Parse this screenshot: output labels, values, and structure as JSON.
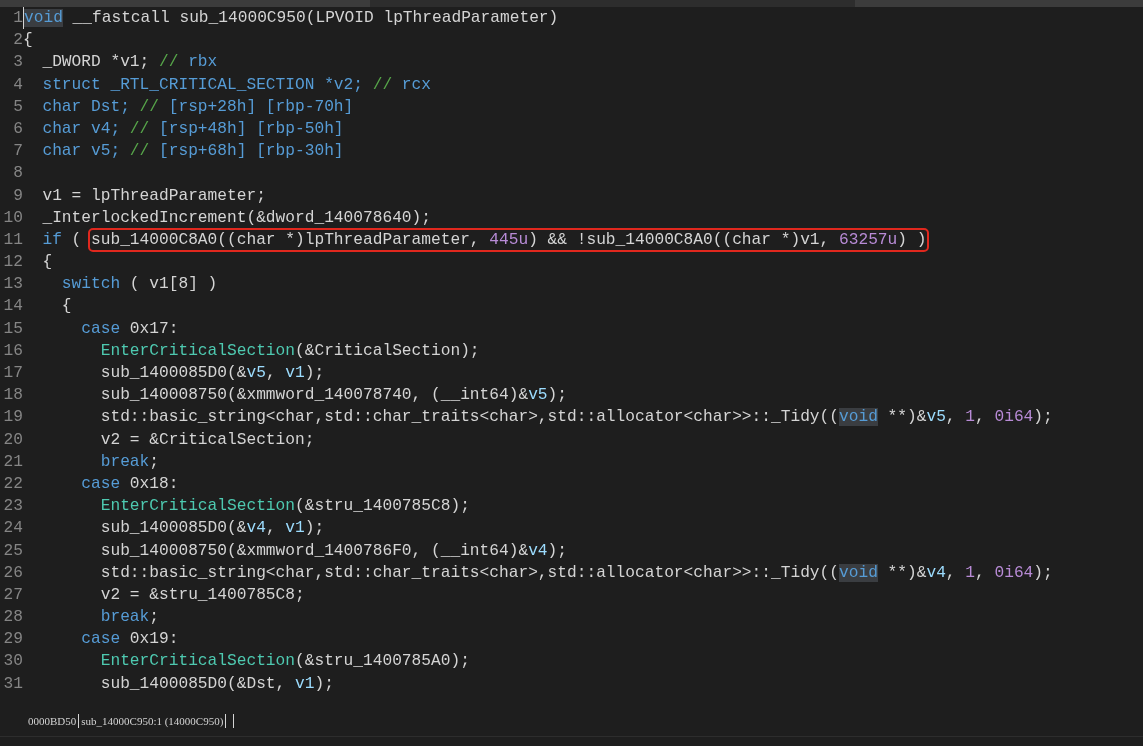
{
  "code_lines": [
    {
      "number": "1",
      "cursor": true,
      "tokens": [
        {
          "kind": "keyword",
          "text": "void",
          "hl": true
        },
        {
          "kind": "plain",
          "text": " __fastcall sub_14000C950(LPVOID lpThreadParameter)"
        }
      ]
    },
    {
      "number": "2",
      "cursor": false,
      "tokens": [
        {
          "kind": "plain",
          "text": "{"
        }
      ]
    },
    {
      "number": "3",
      "cursor": false,
      "tokens": [
        {
          "kind": "plain",
          "text": "  _DWORD *v1; "
        },
        {
          "kind": "comment",
          "text": "//"
        },
        {
          "kind": "register",
          "text": " rbx"
        }
      ]
    },
    {
      "number": "4",
      "cursor": false,
      "tokens": [
        {
          "kind": "keyword",
          "text": "  struct _RTL_CRITICAL_SECTION *v2; "
        },
        {
          "kind": "comment",
          "text": "//"
        },
        {
          "kind": "register",
          "text": " rcx"
        }
      ]
    },
    {
      "number": "5",
      "cursor": false,
      "tokens": [
        {
          "kind": "keyword",
          "text": "  char Dst; "
        },
        {
          "kind": "comment",
          "text": "//"
        },
        {
          "kind": "register",
          "text": " [rsp+28h] [rbp-70h]"
        }
      ]
    },
    {
      "number": "6",
      "cursor": false,
      "tokens": [
        {
          "kind": "keyword",
          "text": "  char v4; "
        },
        {
          "kind": "comment",
          "text": "//"
        },
        {
          "kind": "register",
          "text": " [rsp+48h] [rbp-50h]"
        }
      ]
    },
    {
      "number": "7",
      "cursor": false,
      "tokens": [
        {
          "kind": "keyword",
          "text": "  char v5; "
        },
        {
          "kind": "comment",
          "text": "//"
        },
        {
          "kind": "register",
          "text": " [rsp+68h] [rbp-30h]"
        }
      ]
    },
    {
      "number": "8",
      "cursor": false
    },
    {
      "number": "9",
      "cursor": false,
      "tokens": [
        {
          "kind": "plain",
          "text": "  v1 = lpThreadParameter;"
        }
      ]
    },
    {
      "number": "10",
      "cursor": false,
      "tokens": [
        {
          "kind": "plain",
          "text": "  _InterlockedIncrement(&dword_140078640);"
        }
      ]
    },
    {
      "number": "11",
      "cursor": false,
      "tokens": [
        {
          "kind": "keyword",
          "text": "  if"
        },
        {
          "kind": "plain",
          "text": " ( "
        },
        {
          "kind": "group",
          "boxed": true,
          "tokens": [
            {
              "kind": "plain",
              "text": "sub_14000C8A0((char *)lpThreadParameter, "
            },
            {
              "kind": "number",
              "text": "445u"
            },
            {
              "kind": "plain",
              "text": ") && !sub_14000C8A0((char *)v1, "
            },
            {
              "kind": "number",
              "text": "63257u"
            },
            {
              "kind": "plain",
              "text": ") )"
            }
          ]
        }
      ]
    },
    {
      "number": "12",
      "cursor": false,
      "tokens": [
        {
          "kind": "plain",
          "text": "  {"
        }
      ]
    },
    {
      "number": "13",
      "cursor": false,
      "tokens": [
        {
          "kind": "keyword",
          "text": "    switch"
        },
        {
          "kind": "plain",
          "text": " ( v1[8] )"
        }
      ]
    },
    {
      "number": "14",
      "cursor": false,
      "tokens": [
        {
          "kind": "plain",
          "text": "    {"
        }
      ]
    },
    {
      "number": "15",
      "cursor": false,
      "tokens": [
        {
          "kind": "keyword",
          "text": "      case"
        },
        {
          "kind": "plain",
          "text": " 0x17:"
        }
      ]
    },
    {
      "number": "16",
      "cursor": false,
      "tokens": [
        {
          "kind": "function",
          "text": "        EnterCriticalSection"
        },
        {
          "kind": "plain",
          "text": "(&CriticalSection);"
        }
      ]
    },
    {
      "number": "17",
      "cursor": false,
      "tokens": [
        {
          "kind": "plain",
          "text": "        sub_1400085D0(&"
        },
        {
          "kind": "variable",
          "text": "v5"
        },
        {
          "kind": "plain",
          "text": ", "
        },
        {
          "kind": "variable",
          "text": "v1"
        },
        {
          "kind": "plain",
          "text": ");"
        }
      ]
    },
    {
      "number": "18",
      "cursor": false,
      "tokens": [
        {
          "kind": "plain",
          "text": "        sub_140008750(&xmmword_140078740, (__int64)&"
        },
        {
          "kind": "variable",
          "text": "v5"
        },
        {
          "kind": "plain",
          "text": ");"
        }
      ]
    },
    {
      "number": "19",
      "cursor": false,
      "tokens": [
        {
          "kind": "plain",
          "text": "        std::basic_string<char,std::char_traits<char>,std::allocator<char>>::_Tidy(("
        },
        {
          "kind": "keyword",
          "text": "void",
          "hl": true
        },
        {
          "kind": "plain",
          "text": " **)&"
        },
        {
          "kind": "variable",
          "text": "v5"
        },
        {
          "kind": "plain",
          "text": ", "
        },
        {
          "kind": "number",
          "text": "1"
        },
        {
          "kind": "plain",
          "text": ", "
        },
        {
          "kind": "number",
          "text": "0i64"
        },
        {
          "kind": "plain",
          "text": ");"
        }
      ]
    },
    {
      "number": "20",
      "cursor": false,
      "tokens": [
        {
          "kind": "plain",
          "text": "        v2 = &CriticalSection;"
        }
      ]
    },
    {
      "number": "21",
      "cursor": false,
      "tokens": [
        {
          "kind": "keyword",
          "text": "        break"
        },
        {
          "kind": "plain",
          "text": ";"
        }
      ]
    },
    {
      "number": "22",
      "cursor": false,
      "tokens": [
        {
          "kind": "keyword",
          "text": "      case"
        },
        {
          "kind": "plain",
          "text": " 0x18:"
        }
      ]
    },
    {
      "number": "23",
      "cursor": false,
      "tokens": [
        {
          "kind": "function",
          "text": "        EnterCriticalSection"
        },
        {
          "kind": "plain",
          "text": "(&stru_1400785C8);"
        }
      ]
    },
    {
      "number": "24",
      "cursor": false,
      "tokens": [
        {
          "kind": "plain",
          "text": "        sub_1400085D0(&"
        },
        {
          "kind": "variable",
          "text": "v4"
        },
        {
          "kind": "plain",
          "text": ", "
        },
        {
          "kind": "variable",
          "text": "v1"
        },
        {
          "kind": "plain",
          "text": ");"
        }
      ]
    },
    {
      "number": "25",
      "cursor": false,
      "tokens": [
        {
          "kind": "plain",
          "text": "        sub_140008750(&xmmword_1400786F0, (__int64)&"
        },
        {
          "kind": "variable",
          "text": "v4"
        },
        {
          "kind": "plain",
          "text": ");"
        }
      ]
    },
    {
      "number": "26",
      "cursor": false,
      "tokens": [
        {
          "kind": "plain",
          "text": "        std::basic_string<char,std::char_traits<char>,std::allocator<char>>::_Tidy(("
        },
        {
          "kind": "keyword",
          "text": "void",
          "hl": true
        },
        {
          "kind": "plain",
          "text": " **)&"
        },
        {
          "kind": "variable",
          "text": "v4"
        },
        {
          "kind": "plain",
          "text": ", "
        },
        {
          "kind": "number",
          "text": "1"
        },
        {
          "kind": "plain",
          "text": ", "
        },
        {
          "kind": "number",
          "text": "0i64"
        },
        {
          "kind": "plain",
          "text": ");"
        }
      ]
    },
    {
      "number": "27",
      "cursor": false,
      "tokens": [
        {
          "kind": "plain",
          "text": "        v2 = &stru_1400785C8;"
        }
      ]
    },
    {
      "number": "28",
      "cursor": false,
      "tokens": [
        {
          "kind": "keyword",
          "text": "        break"
        },
        {
          "kind": "plain",
          "text": ";"
        }
      ]
    },
    {
      "number": "29",
      "cursor": false,
      "tokens": [
        {
          "kind": "keyword",
          "text": "      case"
        },
        {
          "kind": "plain",
          "text": " 0x19:"
        }
      ]
    },
    {
      "number": "30",
      "cursor": false,
      "tokens": [
        {
          "kind": "function",
          "text": "        EnterCriticalSection"
        },
        {
          "kind": "plain",
          "text": "(&stru_1400785A0);"
        }
      ]
    },
    {
      "number": "31",
      "cursor": false,
      "tokens": [
        {
          "kind": "plain",
          "text": "        sub_1400085D0(&Dst, "
        },
        {
          "kind": "variable",
          "text": "v1"
        },
        {
          "kind": "plain",
          "text": ");"
        }
      ]
    }
  ],
  "status_bar": [
    "0000BD50",
    "sub_14000C950:1 (14000C950)"
  ]
}
